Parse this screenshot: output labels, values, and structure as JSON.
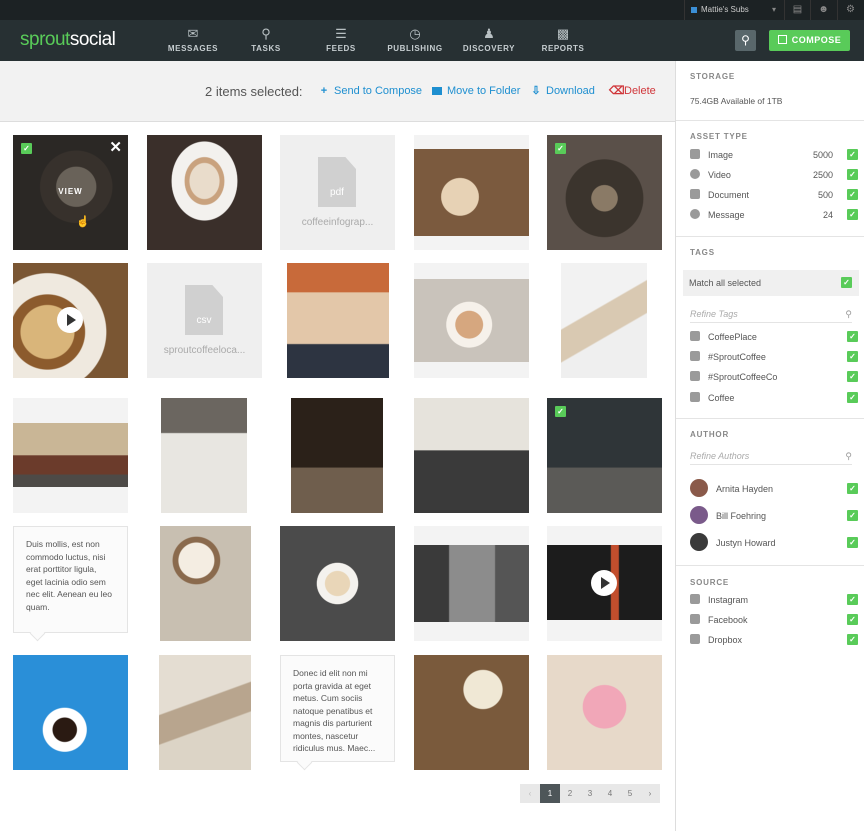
{
  "topbar": {
    "account": "Mattie's Subs"
  },
  "nav": {
    "logo_part1": "sprout",
    "logo_part2": "social",
    "items": [
      {
        "label": "MESSAGES",
        "icon": "envelope-icon"
      },
      {
        "label": "TASKS",
        "icon": "pin-icon"
      },
      {
        "label": "FEEDS",
        "icon": "feeds-icon"
      },
      {
        "label": "PUBLISHING",
        "icon": "clock-icon"
      },
      {
        "label": "DISCOVERY",
        "icon": "person-icon"
      },
      {
        "label": "REPORTS",
        "icon": "bars-icon"
      }
    ],
    "compose_label": "COMPOSE"
  },
  "actionbar": {
    "selected": "2 items selected:",
    "send": "Send to Compose",
    "move": "Move to Folder",
    "download": "Download",
    "delete": "Delete"
  },
  "assets": {
    "view_label": "VIEW",
    "file1": {
      "ext": "pdf",
      "name": "coffeeinfograp..."
    },
    "file2": {
      "ext": "csv",
      "name": "sproutcoffeeloca..."
    },
    "msg1": "Duis mollis, est non commodo luctus, nisi erat porttitor ligula, eget lacinia odio sem nec elit. Aenean eu leo quam.",
    "msg2": "Donec id elit non mi porta gravida at eget metus. Cum sociis natoque penatibus et magnis dis parturient montes, nascetur ridiculus mus. Maec..."
  },
  "pager": {
    "pages": [
      "1",
      "2",
      "3",
      "4",
      "5"
    ]
  },
  "sidebar": {
    "storage_h": "STORAGE",
    "storage_text": "75.4GB Available of 1TB",
    "asset_h": "ASSET TYPE",
    "asset_types": [
      {
        "label": "Image",
        "count": "5000"
      },
      {
        "label": "Video",
        "count": "2500"
      },
      {
        "label": "Document",
        "count": "500"
      },
      {
        "label": "Message",
        "count": "24"
      }
    ],
    "tags_h": "TAGS",
    "match_all": "Match all selected",
    "refine_tags": "Refine Tags",
    "tags": [
      "CoffeePlace",
      "#SproutCoffee",
      "#SproutCoffeeCo",
      "Coffee"
    ],
    "author_h": "AUTHOR",
    "refine_authors": "Refine Authors",
    "authors": [
      "Arnita Hayden",
      "Bill Foehring",
      "Justyn Howard"
    ],
    "source_h": "SOURCE",
    "sources": [
      "Instagram",
      "Facebook",
      "Dropbox"
    ]
  }
}
